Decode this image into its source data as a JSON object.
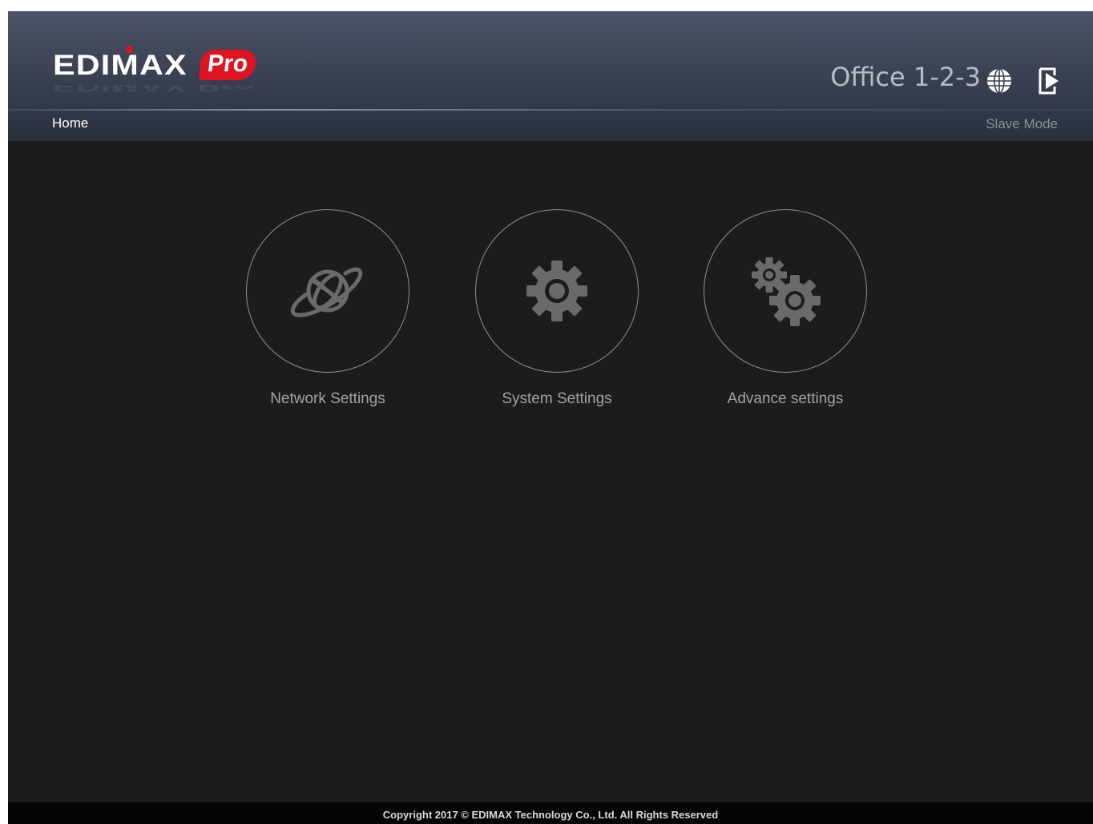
{
  "header": {
    "logo_text": "EDIMAX",
    "logo_badge": "Pro",
    "device_name": "Office 1-2-3",
    "globe_icon": "globe-icon",
    "logout_icon": "logout-icon"
  },
  "breadcrumb": {
    "home": "Home"
  },
  "status": {
    "mode": "Slave Mode"
  },
  "tiles": [
    {
      "label": "Network Settings",
      "icon": "network-globe-icon"
    },
    {
      "label": "System Settings",
      "icon": "gear-icon"
    },
    {
      "label": "Advance settings",
      "icon": "gears-icon"
    }
  ],
  "footer": {
    "copyright": "Copyright 2017 © EDIMAX Technology Co., Ltd. All Rights Reserved"
  },
  "colors": {
    "brand_red": "#e0141e",
    "header_top": "#4b5366",
    "header_bottom": "#2b303d",
    "page_bg": "#1c1c1c",
    "icon_gray": "#6a6a6a"
  }
}
